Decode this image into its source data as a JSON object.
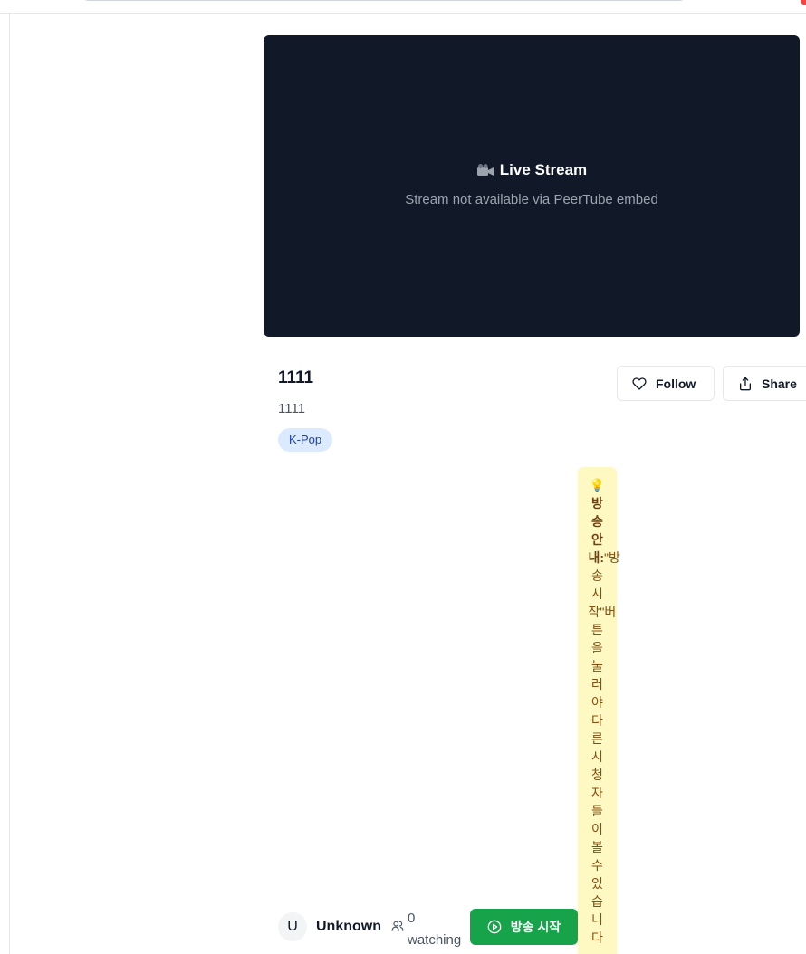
{
  "player": {
    "title": "Live Stream",
    "message": "Stream not available via PeerTube embed"
  },
  "stream": {
    "title": "1111",
    "description": "1111",
    "tag": "K-Pop"
  },
  "actions": {
    "follow_label": "Follow",
    "share_label": "Share"
  },
  "notice": {
    "icon": "lightbulb-icon",
    "heading": "방송 안내:",
    "body": "\"방송 시작\"버튼을 눌러야 다른 시청자들이 볼 수 있습니다"
  },
  "owner": {
    "avatar_letter": "U",
    "name": "Unknown"
  },
  "viewers": {
    "count_text": "0 watching"
  },
  "start": {
    "label": "방송 시작"
  },
  "colors": {
    "player_bg": "#111827",
    "accent_green": "#16a34a",
    "tag_bg": "#dbeafe",
    "notice_bg": "#fef9c3"
  }
}
